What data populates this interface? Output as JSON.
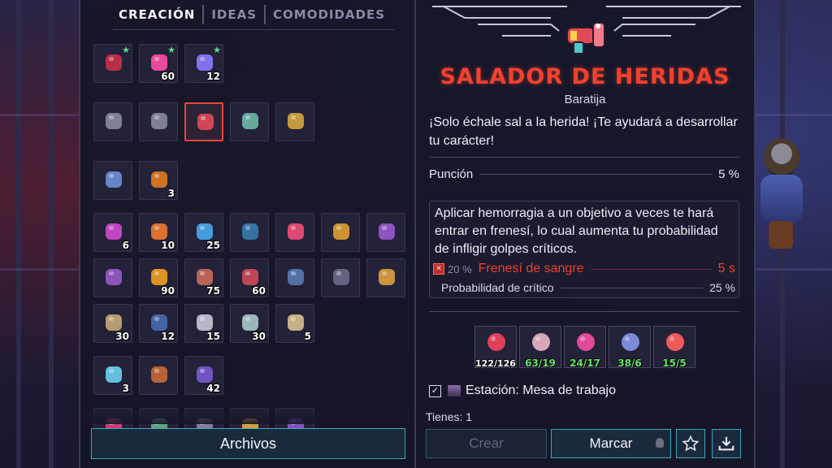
{
  "tabs": [
    {
      "label": "CREACIÓN",
      "active": true
    },
    {
      "label": "IDEAS",
      "active": false
    },
    {
      "label": "COMODIDADES",
      "active": false
    }
  ],
  "grid": {
    "rows": [
      [
        {
          "icon": "flower-wand-icon",
          "count": "",
          "new": true,
          "color": "#c8304a"
        },
        {
          "icon": "pink-crystal-cluster-icon",
          "count": "60",
          "new": true,
          "color": "#ff4fa8"
        },
        {
          "icon": "gem-plate-icon",
          "count": "12",
          "new": true,
          "color": "#8a7cff"
        }
      ],
      [
        {
          "icon": "spear-icon",
          "count": "",
          "color": "#8a8aa0"
        },
        {
          "icon": "spear-icon",
          "count": "",
          "color": "#8a8aa0"
        },
        {
          "icon": "salt-shaker-gun-icon",
          "count": "",
          "selected": true,
          "color": "#e24a5a"
        },
        {
          "icon": "crystal-blade-icon",
          "count": "",
          "color": "#6fb8a8"
        },
        {
          "icon": "scroll-tube-icon",
          "count": "",
          "color": "#d6a640"
        }
      ],
      [
        {
          "icon": "swirl-armor-icon",
          "count": "",
          "color": "#6f8fd6"
        },
        {
          "icon": "horn-icon",
          "count": "3",
          "color": "#e07a20"
        }
      ],
      [
        {
          "icon": "circuit-chip-icon",
          "count": "6",
          "color": "#d04ad0"
        },
        {
          "icon": "flame-bulb-icon",
          "count": "10",
          "color": "#f07a30"
        },
        {
          "icon": "energy-canister-icon",
          "count": "25",
          "color": "#4aa8f0"
        },
        {
          "icon": "blue-panel-icon",
          "count": "",
          "color": "#3a7ab0"
        },
        {
          "icon": "pink-flesh-icon",
          "count": "",
          "color": "#f0507a"
        },
        {
          "icon": "tentacle-pot-icon",
          "count": "",
          "color": "#e0a030"
        },
        {
          "icon": "vine-coil-icon",
          "count": "",
          "color": "#9a5ad0"
        }
      ],
      [
        {
          "icon": "purple-box-icon",
          "count": "",
          "color": "#9a5ac8"
        },
        {
          "icon": "gold-cubes-icon",
          "count": "90",
          "color": "#f0a020"
        },
        {
          "icon": "wood-planks-icon",
          "count": "75",
          "color": "#c86a5a"
        },
        {
          "icon": "berry-tray-icon",
          "count": "60",
          "color": "#d04a5a"
        },
        {
          "icon": "sand-pile-icon",
          "count": "",
          "color": "#5a7ab0"
        },
        {
          "icon": "metal-roll-icon",
          "count": "",
          "color": "#6a6a8a"
        },
        {
          "icon": "potion-bag-icon",
          "count": "",
          "color": "#e0a040"
        }
      ],
      [
        {
          "icon": "stone-block-icon",
          "count": "30",
          "color": "#c8a878"
        },
        {
          "icon": "feather-bundle-icon",
          "count": "12",
          "color": "#4a6ab0"
        },
        {
          "icon": "silver-plate-icon",
          "count": "15",
          "color": "#c8c8d8"
        },
        {
          "icon": "cloud-bones-icon",
          "count": "30",
          "color": "#a8c8c8"
        },
        {
          "icon": "clay-jug-icon",
          "count": "5",
          "color": "#d8c090"
        }
      ],
      [
        {
          "icon": "ice-log-icon",
          "count": "3",
          "color": "#6ad0f0"
        },
        {
          "icon": "meat-skewer-icon",
          "count": "",
          "color": "#c86a3a"
        },
        {
          "icon": "spiky-club-icon",
          "count": "42",
          "color": "#7a5ad0"
        }
      ],
      [
        {
          "icon": "rose-icon",
          "count": "",
          "color": "#e0407a"
        },
        {
          "icon": "green-spear-icon",
          "count": "",
          "color": "#6ab08a"
        },
        {
          "icon": "staff-icon",
          "count": "",
          "color": "#8a8aa8"
        },
        {
          "icon": "golden-spear-icon",
          "count": "",
          "color": "#e0b040"
        },
        {
          "icon": "purple-staff-icon",
          "count": "",
          "color": "#8a5ad0"
        }
      ]
    ]
  },
  "files_label": "Archivos",
  "item": {
    "icon": "salt-shaker-gun-icon",
    "name": "SALADOR DE HERIDAS",
    "type": "Baratija",
    "description": "¡Solo échale sal a la herida! ¡Te ayudará a desarrollar tu carácter!",
    "stat_name": "Punción",
    "stat_value": "5 %",
    "effect_text": "Aplicar hemorragia a un objetivo a veces te hará entrar en frenesí, lo cual aumenta tu probabilidad de infligir golpes críticos.",
    "buff_chance": "20 %",
    "buff_name": "Frenesí de sangre",
    "buff_duration": "5 s",
    "crit_label": "Probabilidad de crítico",
    "crit_value": "25 %"
  },
  "ingredients": [
    {
      "icon": "red-coral-icon",
      "count": "122/126",
      "color": "#e0405a",
      "ok": false
    },
    {
      "icon": "flower-sample-icon",
      "count": "63/19",
      "color": "#d8a8b8",
      "ok": true
    },
    {
      "icon": "pink-spore-icon",
      "count": "24/17",
      "color": "#e04a9a",
      "ok": true
    },
    {
      "icon": "blue-rock-icon",
      "count": "38/6",
      "color": "#7a8ad8",
      "ok": true
    },
    {
      "icon": "fire-flower-icon",
      "count": "15/5",
      "color": "#f05a5a",
      "ok": true
    }
  ],
  "station": {
    "checked": true,
    "label": "Estación: Mesa de trabajo"
  },
  "owned": "Tienes: 1",
  "buttons": {
    "craft": "Crear",
    "mark": "Marcar"
  }
}
